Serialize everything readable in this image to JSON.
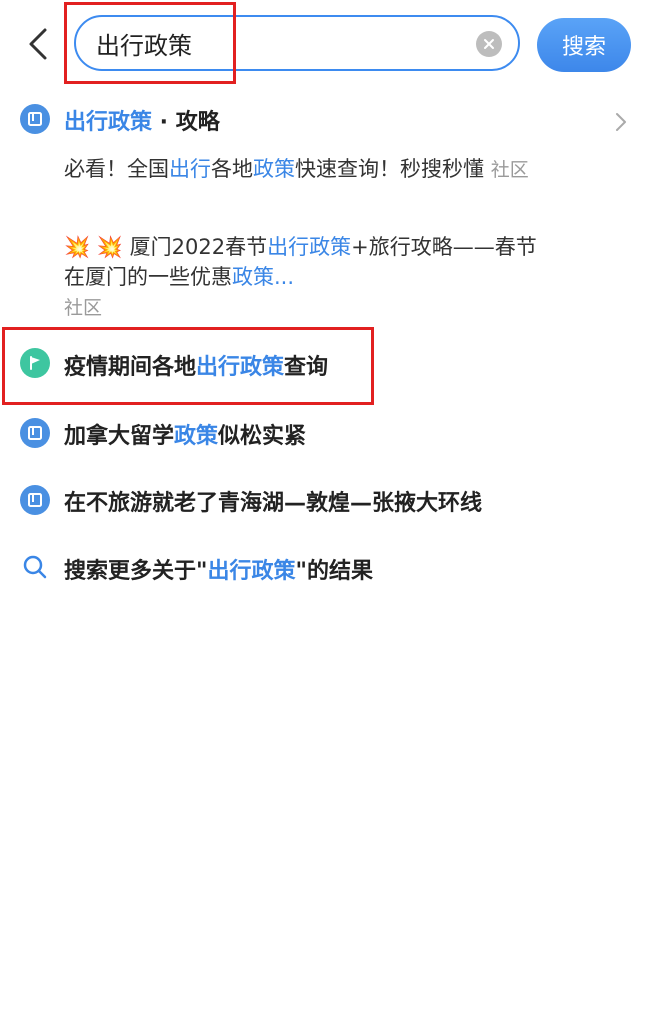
{
  "search": {
    "query": "出行政策",
    "button_label": "搜索"
  },
  "suggestions": {
    "guide": {
      "title_highlight": "出行政策",
      "title_rest": " · 攻略",
      "items": [
        {
          "parts": [
            "必看！全国",
            "出行",
            "各地",
            "政策",
            "快速查询！秒搜秒懂"
          ],
          "tag": "社区"
        },
        {
          "emoji": "💥 💥",
          "parts": [
            "厦门2022春节",
            "出行政策",
            "+旅行攻略——春节在厦门的一些优惠",
            "政策",
            "..."
          ],
          "tag": "社区"
        }
      ]
    },
    "rows": [
      {
        "parts": [
          "疫情期间各地",
          "出行政策",
          "查询"
        ]
      },
      {
        "parts": [
          "加拿大留学",
          "政策",
          "似松实紧"
        ]
      },
      {
        "text": "在不旅游就老了青海湖—敦煌—张掖大环线"
      }
    ],
    "more": {
      "prefix": "搜索更多关于\"",
      "highlight": "出行政策",
      "suffix": "\"的结果"
    }
  },
  "colors": {
    "accent": "#3a86e6",
    "annotation_red": "#e22020"
  }
}
